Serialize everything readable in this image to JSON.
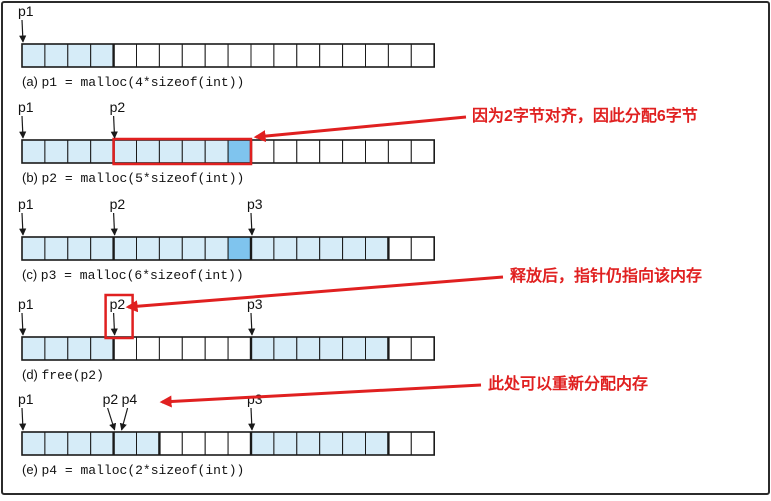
{
  "colors": {
    "frame_border": "#2b2b2b",
    "cell_border": "#1a1a1a",
    "allocated_fill": "#d6ecf8",
    "padding_fill": "#7fc4ee",
    "free_fill": "#ffffff",
    "annotation_red": "#e02020"
  },
  "heap": {
    "total_words": 18
  },
  "panels": [
    {
      "caption_label": "(a)",
      "caption_code": "p1 = malloc(4*sizeof(int))",
      "pointers": [
        {
          "label": "p1",
          "word": 0
        }
      ],
      "allocated": [
        [
          0,
          4
        ]
      ],
      "padding": [],
      "bold_boundaries": [
        4
      ]
    },
    {
      "caption_label": "(b)",
      "caption_code": "p2 = malloc(5*sizeof(int))",
      "pointers": [
        {
          "label": "p1",
          "word": 0
        },
        {
          "label": "p2",
          "word": 4
        }
      ],
      "allocated": [
        [
          0,
          10
        ]
      ],
      "padding": [
        9
      ],
      "bold_boundaries": [
        4,
        10
      ],
      "highlight_box": [
        4,
        10
      ]
    },
    {
      "caption_label": "(c)",
      "caption_code": "p3 = malloc(6*sizeof(int))",
      "pointers": [
        {
          "label": "p1",
          "word": 0
        },
        {
          "label": "p2",
          "word": 4
        },
        {
          "label": "p3",
          "word": 10
        }
      ],
      "allocated": [
        [
          0,
          16
        ]
      ],
      "padding": [
        9
      ],
      "bold_boundaries": [
        4,
        10,
        16
      ]
    },
    {
      "caption_label": "(d)",
      "caption_code": "free(p2)",
      "pointers": [
        {
          "label": "p1",
          "word": 0
        },
        {
          "label": "p2",
          "word": 4
        },
        {
          "label": "p3",
          "word": 10
        }
      ],
      "allocated": [
        [
          0,
          4
        ],
        [
          10,
          16
        ]
      ],
      "padding": [],
      "bold_boundaries": [
        4,
        10,
        16
      ],
      "highlight_pointer": 1
    },
    {
      "caption_label": "(e)",
      "caption_code": "p4 = malloc(2*sizeof(int))",
      "pointers": [
        {
          "label": "p1",
          "word": 0
        },
        {
          "label": "p2",
          "word": 4
        },
        {
          "label": "p4",
          "word": 4
        },
        {
          "label": "p3",
          "word": 10
        }
      ],
      "allocated": [
        [
          0,
          6
        ],
        [
          10,
          16
        ]
      ],
      "padding": [],
      "bold_boundaries": [
        4,
        6,
        10,
        16
      ]
    }
  ],
  "annotations": [
    {
      "text": "因为2字节对齐，因此分配6字节",
      "points_to_panel": 1
    },
    {
      "text": "释放后，指针仍指向该内存",
      "points_to_panel": 3
    },
    {
      "text": "此处可以重新分配内存",
      "points_to_panel": 4
    }
  ]
}
